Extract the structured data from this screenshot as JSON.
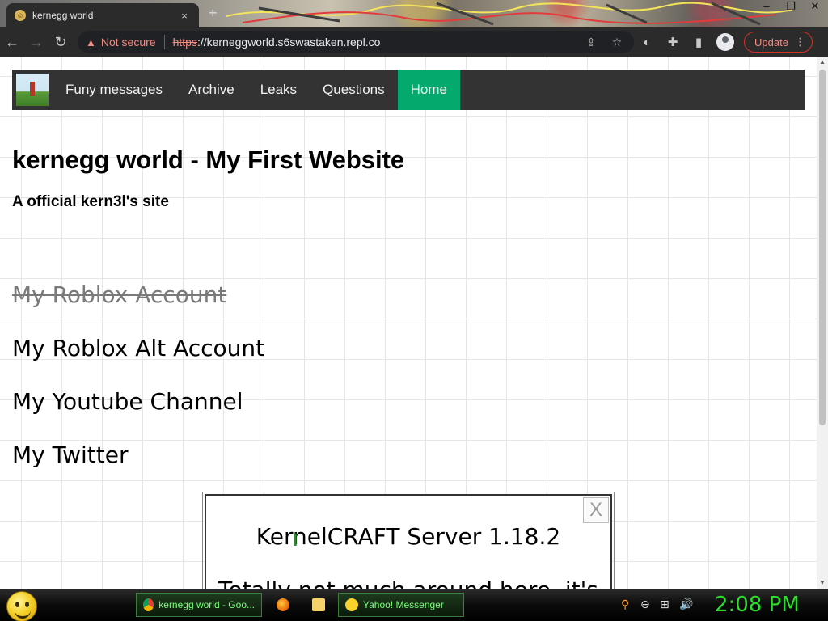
{
  "browser": {
    "tab_title": "kernegg world",
    "tab_close": "×",
    "new_tab": "+",
    "security_label": "Not secure",
    "url_scheme": "https",
    "url_rest": "://kerneggworld.s6swastaken.repl.co",
    "update_label": "Update",
    "icons": [
      "back-icon",
      "forward-icon",
      "reload-icon",
      "warning-icon",
      "share-icon",
      "star-icon",
      "extension-icon",
      "puzzle-icon",
      "sidepanel-icon",
      "profile-icon",
      "menu-icon"
    ]
  },
  "site": {
    "nav": [
      {
        "label": "Funy messages",
        "active": false
      },
      {
        "label": "Archive",
        "active": false
      },
      {
        "label": "Leaks",
        "active": false
      },
      {
        "label": "Questions",
        "active": false
      },
      {
        "label": "Home",
        "active": true
      }
    ],
    "heading": "kernegg world - My First Website",
    "subheading": "A official kern3l's site",
    "links": [
      {
        "label": "My Roblox Account",
        "struck": true
      },
      {
        "label": "My Roblox Alt Account",
        "struck": false
      },
      {
        "label": "My Youtube Channel",
        "struck": false
      },
      {
        "label": "My Twitter",
        "struck": false
      }
    ],
    "popup": {
      "close_label": "X",
      "title": "KernelCRAFT Server 1.18.2",
      "body": "Totally not much around here, it's"
    },
    "colors": {
      "nav_bg": "#333333",
      "nav_active": "#04aa6d"
    }
  },
  "taskbar": {
    "tasks": [
      {
        "label": "kernegg world - Goo...",
        "icon": "chrome-icon"
      },
      {
        "label": "",
        "icon": "firefox-icon"
      },
      {
        "label": "",
        "icon": "folder-icon"
      },
      {
        "label": "Yahoo! Messenger",
        "icon": "yahoo-messenger-icon"
      }
    ],
    "clock": "2:08 PM"
  }
}
